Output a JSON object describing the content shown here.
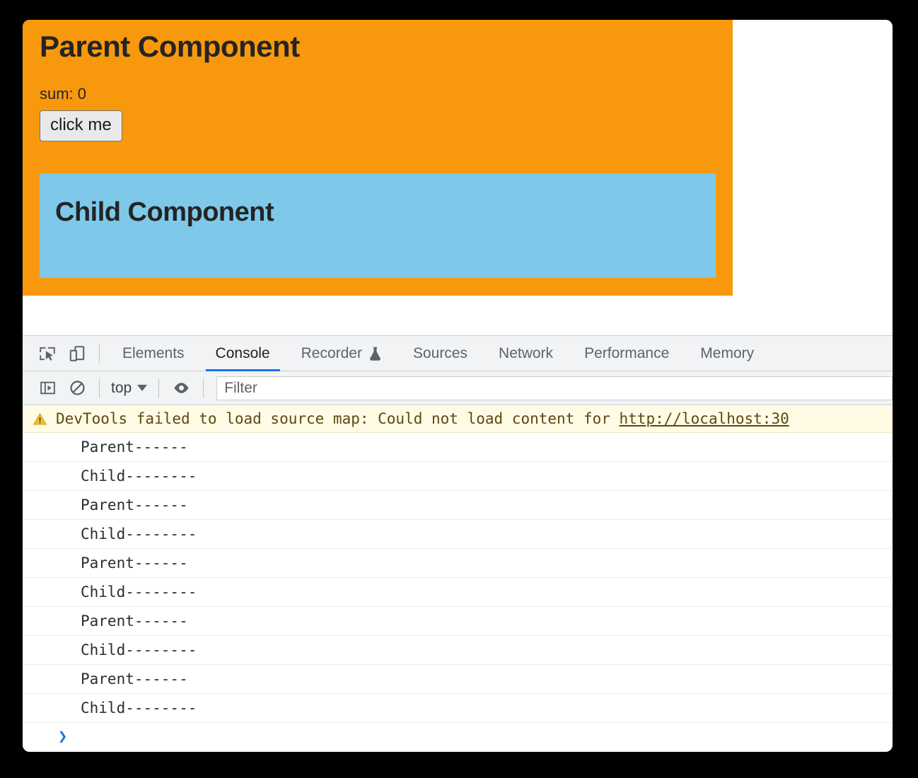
{
  "app": {
    "parent": {
      "title": "Parent Component",
      "sum_label": "sum: 0",
      "button_label": "click me",
      "bg_color": "#f8990d"
    },
    "child": {
      "title": "Child Component",
      "bg_color": "#7ec8ea"
    }
  },
  "devtools": {
    "toolbar_icons": [
      {
        "name": "inspect-element-icon",
        "title": "Inspect element"
      },
      {
        "name": "device-toolbar-icon",
        "title": "Toggle device toolbar"
      }
    ],
    "tabs": [
      {
        "label": "Elements",
        "active": false,
        "icon": ""
      },
      {
        "label": "Console",
        "active": true,
        "icon": ""
      },
      {
        "label": "Recorder",
        "active": false,
        "icon": "flask-icon"
      },
      {
        "label": "Sources",
        "active": false,
        "icon": ""
      },
      {
        "label": "Network",
        "active": false,
        "icon": ""
      },
      {
        "label": "Performance",
        "active": false,
        "icon": ""
      },
      {
        "label": "Memory",
        "active": false,
        "icon": ""
      }
    ],
    "active_tab_underline_color": "#1a73e8",
    "console_toolbar": {
      "sidebar_toggle_icon": "console-sidebar-icon",
      "clear_icon": "clear-console-icon",
      "context_value": "top",
      "context_caret_icon": "chevron-down-icon",
      "live_expression_icon": "eye-icon",
      "filter_placeholder": "Filter",
      "filter_value": ""
    },
    "console": {
      "warning": {
        "icon": "warning-triangle-icon",
        "text": "DevTools failed to load source map: Could not load content for ",
        "link": "http://localhost:30",
        "bg_color": "#fffbe5",
        "text_color": "#5c4813"
      },
      "logs": [
        "Parent------",
        "Child--------",
        "Parent------",
        "Child--------",
        "Parent------",
        "Child--------",
        "Parent------",
        "Child--------",
        "Parent------",
        "Child--------"
      ],
      "prompt_glyph": "❯",
      "prompt_color": "#1a73e8"
    }
  }
}
